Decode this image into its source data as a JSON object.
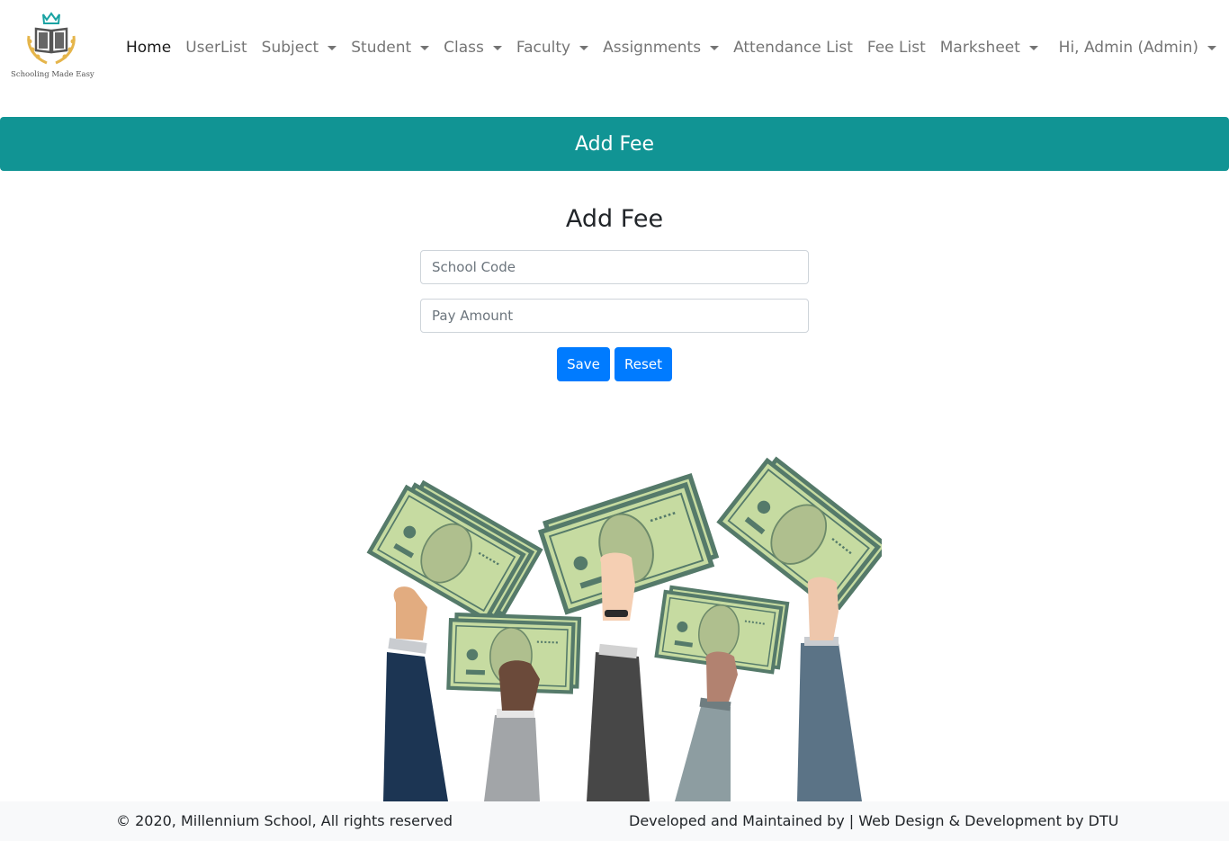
{
  "brand": {
    "tagline": "Schooling Made Easy"
  },
  "nav": {
    "items": [
      {
        "label": "Home",
        "active": true,
        "dropdown": false
      },
      {
        "label": "UserList",
        "active": false,
        "dropdown": false
      },
      {
        "label": "Subject",
        "active": false,
        "dropdown": true
      },
      {
        "label": "Student",
        "active": false,
        "dropdown": true
      },
      {
        "label": "Class",
        "active": false,
        "dropdown": true
      },
      {
        "label": "Faculty",
        "active": false,
        "dropdown": true
      },
      {
        "label": "Assignments",
        "active": false,
        "dropdown": true
      },
      {
        "label": "Attendance List",
        "active": false,
        "dropdown": false
      },
      {
        "label": "Fee List",
        "active": false,
        "dropdown": false
      },
      {
        "label": "Marksheet",
        "active": false,
        "dropdown": true
      }
    ],
    "user_menu": "Hi, Admin (Admin)"
  },
  "banner": {
    "title": "Add Fee",
    "color": "#119494"
  },
  "form": {
    "title": "Add Fee",
    "school_code": {
      "value": "",
      "placeholder": "School Code"
    },
    "pay_amount": {
      "value": "",
      "placeholder": "Pay Amount"
    },
    "save_label": "Save",
    "reset_label": "Reset",
    "button_color": "#007bff"
  },
  "illustration": {
    "icon": "hands-holding-money-illustration"
  },
  "footer": {
    "left": "© 2020, Millennium School, All rights reserved",
    "right": "Developed and Maintained by | Web Design & Development by DTU"
  }
}
